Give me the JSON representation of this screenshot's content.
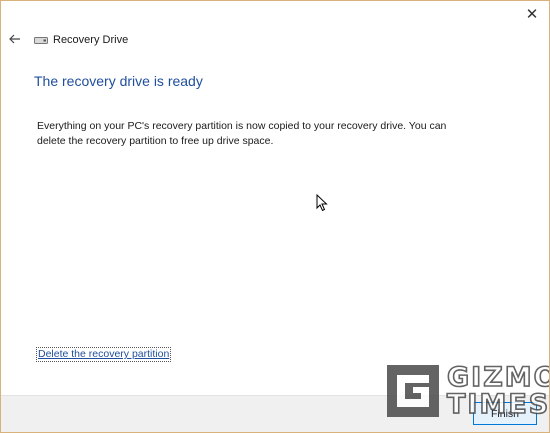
{
  "window": {
    "title": "Recovery Drive",
    "close_glyph": "✕"
  },
  "main": {
    "heading": "The recovery drive is ready",
    "description": "Everything on your PC's recovery partition is now copied to your recovery drive. You can delete the recovery partition to free up drive space.",
    "delete_link": "Delete the recovery partition"
  },
  "footer": {
    "finish_label": "Finish"
  },
  "watermark": {
    "line1": "GIZMO",
    "line2": "TIMES"
  },
  "icons": {
    "back": "arrow-left-icon",
    "drive": "drive-icon",
    "close": "close-icon",
    "cursor": "mouse-cursor-icon",
    "watermark": "gizmotimes-logo-icon"
  },
  "colors": {
    "accent": "#1f4e9c",
    "button_border": "#0078d7",
    "footer_bg": "#f0f0f0",
    "window_border": "#d8b27a"
  }
}
